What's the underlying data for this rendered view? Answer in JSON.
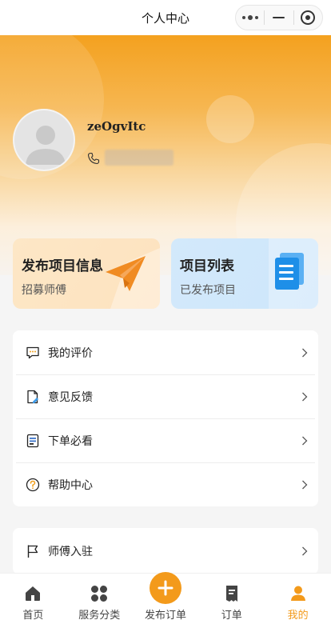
{
  "nav": {
    "title": "个人中心"
  },
  "profile": {
    "username": "zeOgvItc"
  },
  "cards": [
    {
      "title": "发布项目信息",
      "subtitle": "招募师傅"
    },
    {
      "title": "项目列表",
      "subtitle": "已发布项目"
    }
  ],
  "menu1": [
    {
      "label": "我的评价",
      "icon": "comment-icon"
    },
    {
      "label": "意见反馈",
      "icon": "feedback-icon"
    },
    {
      "label": "下单必看",
      "icon": "notice-icon"
    },
    {
      "label": "帮助中心",
      "icon": "help-icon"
    }
  ],
  "menu2": [
    {
      "label": "师傅入驻",
      "icon": "flag-icon"
    }
  ],
  "tabbar": {
    "items": [
      {
        "label": "首页",
        "icon": "home-icon"
      },
      {
        "label": "服务分类",
        "icon": "category-icon"
      },
      {
        "label": "发布订单",
        "icon": "plus-icon"
      },
      {
        "label": "订单",
        "icon": "order-icon"
      },
      {
        "label": "我的",
        "icon": "user-icon"
      }
    ],
    "active_index": 4
  },
  "colors": {
    "accent": "#f39a1b",
    "blue_card": "#cde6fb",
    "orange_card": "#fde2bf"
  }
}
